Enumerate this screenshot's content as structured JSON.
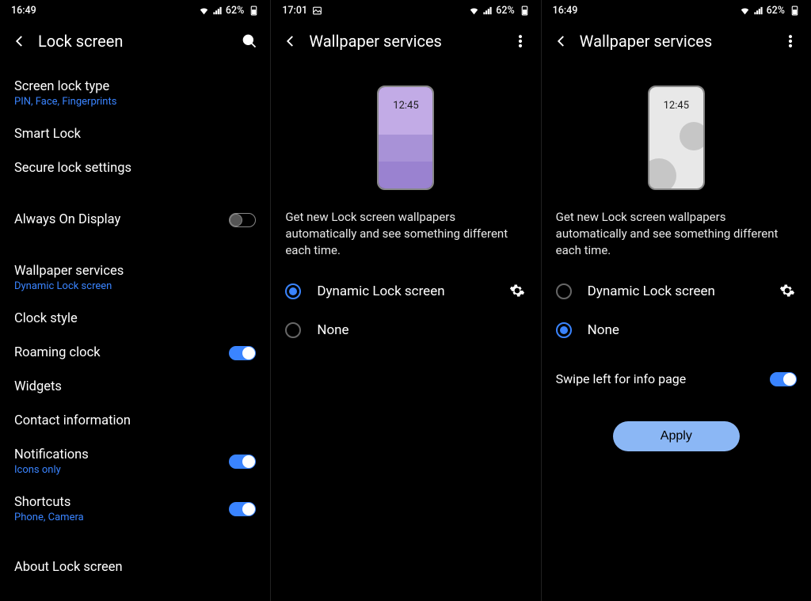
{
  "status": {
    "battery_pct": "62%"
  },
  "panel1": {
    "time": "16:49",
    "title": "Lock screen",
    "items": {
      "screen_lock_type": {
        "title": "Screen lock type",
        "sub": "PIN, Face, Fingerprints"
      },
      "smart_lock": {
        "title": "Smart Lock"
      },
      "secure_lock_settings": {
        "title": "Secure lock settings"
      },
      "aod": {
        "title": "Always On Display"
      },
      "wallpaper_services": {
        "title": "Wallpaper services",
        "sub": "Dynamic Lock screen"
      },
      "clock_style": {
        "title": "Clock style"
      },
      "roaming_clock": {
        "title": "Roaming clock"
      },
      "widgets": {
        "title": "Widgets"
      },
      "contact_info": {
        "title": "Contact information"
      },
      "notifications": {
        "title": "Notifications",
        "sub": "Icons only"
      },
      "shortcuts": {
        "title": "Shortcuts",
        "sub": "Phone, Camera"
      },
      "about": {
        "title": "About Lock screen"
      }
    }
  },
  "panel2": {
    "time": "17:01",
    "title": "Wallpaper services",
    "preview_time": "12:45",
    "desc": "Get new Lock screen wallpapers automatically and see something different each time.",
    "opt_dynamic": "Dynamic Lock screen",
    "opt_none": "None"
  },
  "panel3": {
    "time": "16:49",
    "title": "Wallpaper services",
    "preview_time": "12:45",
    "desc": "Get new Lock screen wallpapers automatically and see something different each time.",
    "opt_dynamic": "Dynamic Lock screen",
    "opt_none": "None",
    "swipe_label": "Swipe left for info page",
    "apply_label": "Apply"
  }
}
